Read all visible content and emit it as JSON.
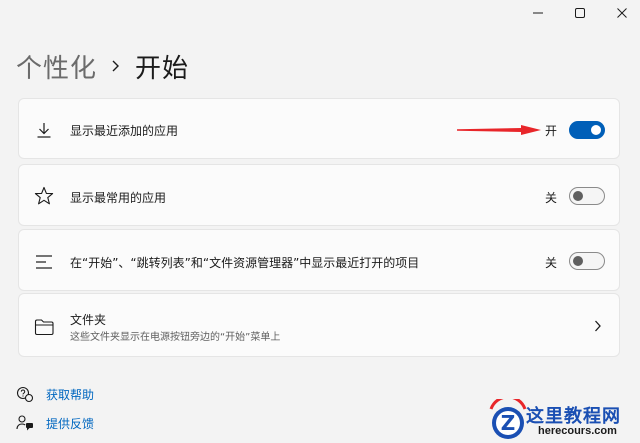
{
  "breadcrumb": {
    "parent": "个性化",
    "current": "开始"
  },
  "settings": [
    {
      "label": "显示最近添加的应用",
      "state": "开",
      "on": true,
      "icon": "download-icon"
    },
    {
      "label": "显示最常用的应用",
      "state": "关",
      "on": false,
      "icon": "star-icon"
    },
    {
      "label": "在“开始”、“跳转列表”和“文件资源管理器”中显示最近打开的项目",
      "state": "关",
      "on": false,
      "icon": "list-icon"
    }
  ],
  "folders": {
    "title": "文件夹",
    "subtitle": "这些文件夹显示在电源按钮旁边的“开始”菜单上",
    "icon": "folder-icon"
  },
  "footer": {
    "help": "获取帮助",
    "feedback": "提供反馈"
  },
  "watermark": {
    "name": "这里教程网",
    "url": "herecours.com"
  },
  "colors": {
    "accent": "#005fb8",
    "link": "#0067c0",
    "annotation_arrow": "#e8262a"
  }
}
